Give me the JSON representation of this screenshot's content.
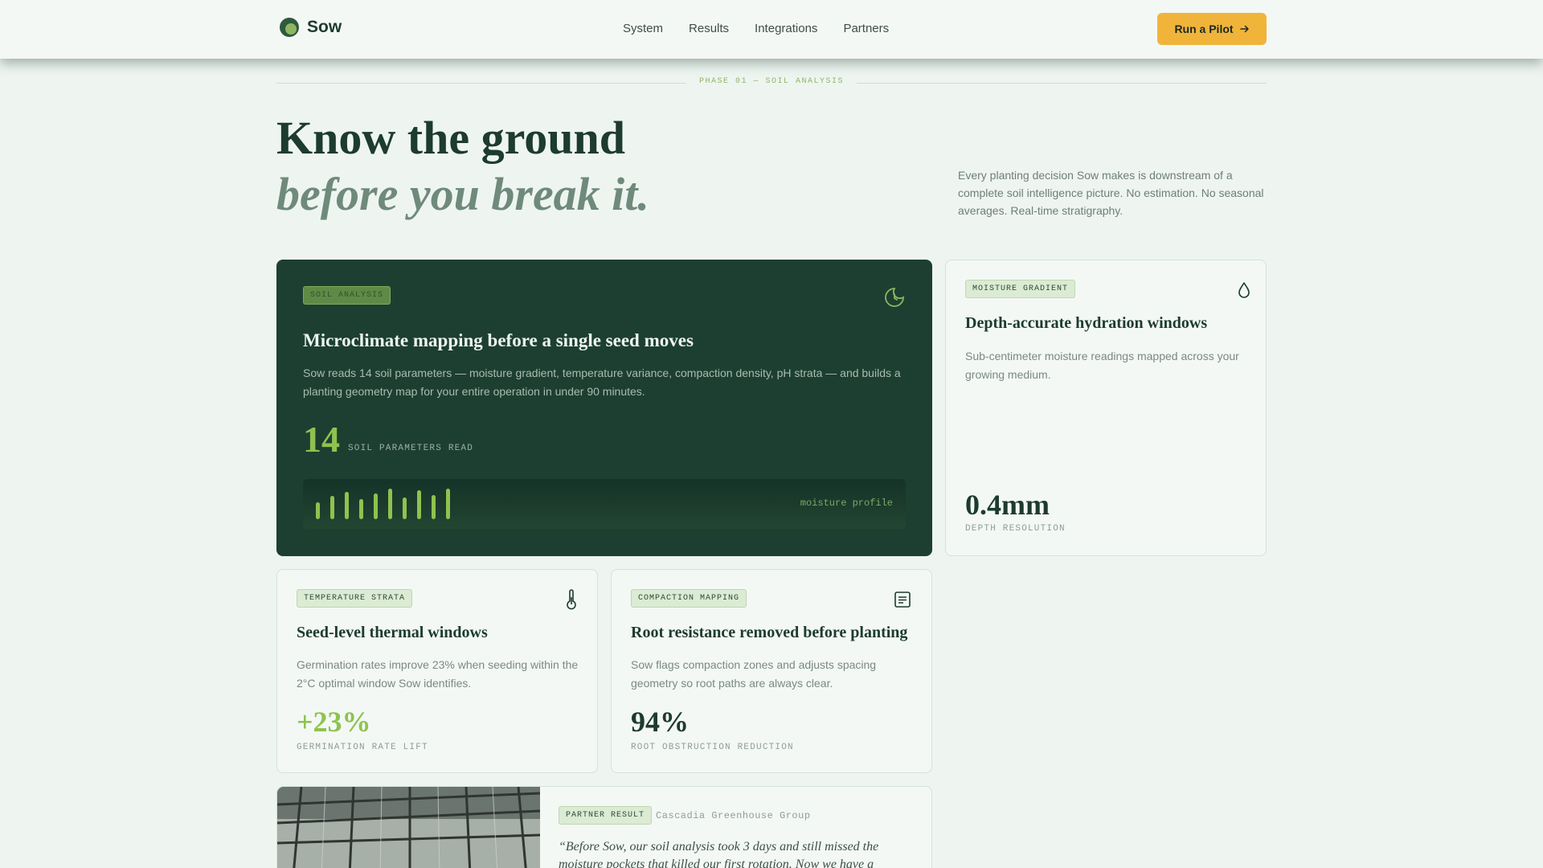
{
  "brand": {
    "name": "Sow"
  },
  "nav": {
    "items": [
      "System",
      "Results",
      "Integrations",
      "Partners"
    ]
  },
  "header": {
    "cta_label": "Run a Pilot"
  },
  "phase": {
    "label": "PHASE 01 — SOIL ANALYSIS"
  },
  "hero": {
    "line1": "Know the ground",
    "line2": "before you break it.",
    "description": "Every planting decision Sow makes is downstream of a complete soil intelligence picture. No estimation. No seasonal averages. Real-time stratigraphy."
  },
  "cards": {
    "soil": {
      "tag": "SOIL ANALYSIS",
      "title": "Microclimate mapping before a single seed moves",
      "description": "Sow reads 14 soil parameters — moisture gradient, temperature variance, compaction density, pH strata — and builds a planting geometry map for your entire operation in under 90 minutes.",
      "metric_value": "14",
      "metric_label": "SOIL PARAMETERS READ",
      "moisture_label": "moisture profile",
      "moisture_bars": [
        0.55,
        0.75,
        0.9,
        0.65,
        0.85,
        1.0,
        0.7,
        0.95,
        0.8,
        1.0
      ]
    },
    "moisture": {
      "tag": "MOISTURE GRADIENT",
      "title": "Depth-accurate hydration windows",
      "description": "Sub-centimeter moisture readings mapped across your growing medium.",
      "metric_value": "0.4mm",
      "metric_label": "DEPTH RESOLUTION"
    },
    "temperature": {
      "tag": "TEMPERATURE STRATA",
      "title": "Seed-level thermal windows",
      "description": "Germination rates improve 23% when seeding within the 2°C optimal window Sow identifies.",
      "metric_value": "+23%",
      "metric_label": "GERMINATION RATE LIFT"
    },
    "compaction": {
      "tag": "COMPACTION MAPPING",
      "title": "Root resistance removed before planting",
      "description": "Sow flags compaction zones and adjusts spacing geometry so root paths are always clear.",
      "metric_value": "94%",
      "metric_label": "ROOT OBSTRUCTION REDUCTION"
    },
    "partner": {
      "tag": "PARTNER RESULT",
      "partner_name": "Cascadia Greenhouse Group",
      "quote": "“Before Sow, our soil analysis took 3 days and still missed the moisture pockets that killed our first rotation. Now we have a"
    }
  },
  "colors": {
    "accent": "#f0b43b",
    "dark_card": "#1d3f31",
    "lime": "#8fc24f",
    "text_dark": "#1d3b2e"
  }
}
